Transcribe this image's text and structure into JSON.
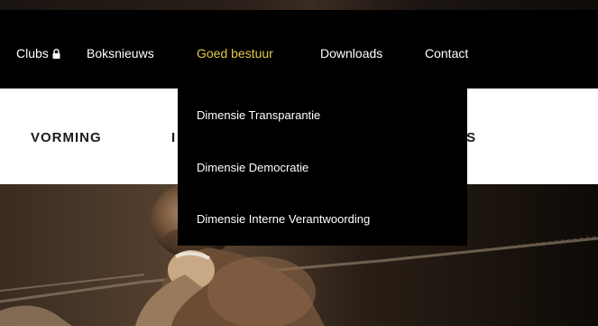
{
  "nav": {
    "items": [
      {
        "label": "Clubs",
        "icon": "lock-icon"
      },
      {
        "label": "Boksnieuws"
      },
      {
        "label": "Goed bestuur",
        "active": true
      },
      {
        "label": "Downloads"
      },
      {
        "label": "Contact"
      }
    ]
  },
  "dropdown": {
    "items": [
      {
        "label": "Dimensie Transparantie"
      },
      {
        "label": "Dimensie Democratie"
      },
      {
        "label": "Dimensie Interne Verantwoording"
      }
    ]
  },
  "subnav": {
    "items": [
      {
        "label": "VORMING"
      },
      {
        "label": "I"
      },
      {
        "label": "IS"
      }
    ]
  },
  "colors": {
    "nav_background": "#000000",
    "nav_text": "#ffffff",
    "accent": "#e3c84a",
    "subnav_text": "#1b1b1b"
  },
  "hero": {
    "icon": "boxer-photo"
  }
}
